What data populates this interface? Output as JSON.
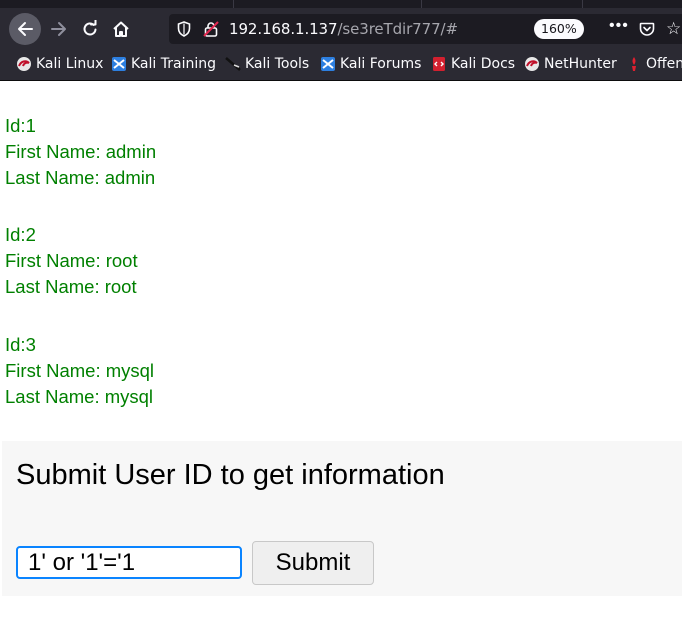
{
  "browser": {
    "url_host": "192.168.1.137",
    "url_path": "/se3reTdir777/#",
    "zoom_level": "160%",
    "page_actions_label": "•••"
  },
  "bookmarks": [
    {
      "label": "Kali Linux",
      "icon": "kali-dragon-icon"
    },
    {
      "label": "Kali Training",
      "icon": "kali-training-icon"
    },
    {
      "label": "Kali Tools",
      "icon": "kali-tools-icon"
    },
    {
      "label": "Kali Forums",
      "icon": "kali-forums-icon"
    },
    {
      "label": "Kali Docs",
      "icon": "kali-docs-icon"
    },
    {
      "label": "NetHunter",
      "icon": "nethunter-icon"
    },
    {
      "label": "Offen",
      "icon": "offensive-security-icon"
    }
  ],
  "records": [
    {
      "id_line": "Id:1",
      "first_name_line": "First Name: admin",
      "last_name_line": "Last Name: admin"
    },
    {
      "id_line": "Id:2",
      "first_name_line": "First Name: root",
      "last_name_line": "Last Name: root"
    },
    {
      "id_line": "Id:3",
      "first_name_line": "First Name: mysql",
      "last_name_line": "Last Name: mysql"
    }
  ],
  "form": {
    "heading": "Submit User ID to get information",
    "input_value": "1' or '1'='1",
    "submit_label": "Submit"
  },
  "colors": {
    "record_text": "#008000",
    "chrome_bg": "#2b2a33",
    "urlbar_bg": "#1c1b22",
    "focus_ring": "#0a84ff"
  }
}
